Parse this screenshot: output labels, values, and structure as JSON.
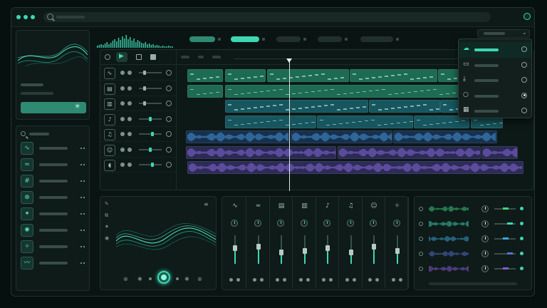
{
  "theme": {
    "accent": "#3fd6b3",
    "bg": "#0a1513",
    "green_clip": "#1d6b52",
    "teal_clip": "#17565e",
    "blue_clip": "#17304e",
    "purple_clip": "#2a2a54"
  },
  "window": {
    "controls": [
      "close-dot",
      "minimize-dot",
      "maximize-dot"
    ]
  },
  "search": {
    "placeholder": ""
  },
  "transport": {
    "buttons": [
      "record",
      "play",
      "loop",
      "stop"
    ]
  },
  "tracks": [
    {
      "icon": "waveform-icon",
      "glyph": "∿"
    },
    {
      "icon": "synth-icon",
      "glyph": "▤"
    },
    {
      "icon": "keyboard-icon",
      "glyph": "▥"
    },
    {
      "icon": "guitar-icon",
      "glyph": "♪"
    },
    {
      "icon": "microphone-icon",
      "glyph": "♫"
    },
    {
      "icon": "group-icon",
      "glyph": "☺"
    },
    {
      "icon": "voice-icon",
      "glyph": "◖"
    }
  ],
  "library": {
    "items": [
      {
        "icon": "wave-icon",
        "glyph": "∿"
      },
      {
        "icon": "wave-icon",
        "glyph": "≈"
      },
      {
        "icon": "grid-icon",
        "glyph": "#"
      },
      {
        "icon": "target-icon",
        "glyph": "⊕"
      },
      {
        "icon": "star-icon",
        "glyph": "✦"
      },
      {
        "icon": "burst-icon",
        "glyph": "✺"
      },
      {
        "icon": "spark-icon",
        "glyph": "✧"
      },
      {
        "icon": "wave-icon",
        "glyph": "〰"
      }
    ]
  },
  "mixer": {
    "channels": [
      {
        "icon": "waveform-icon",
        "glyph": "∿",
        "level": 0.55
      },
      {
        "icon": "wave-icon",
        "glyph": "≈",
        "level": 0.6
      },
      {
        "icon": "synth-icon",
        "glyph": "▤",
        "level": 0.4
      },
      {
        "icon": "keyboard-icon",
        "glyph": "▥",
        "level": 0.45
      },
      {
        "icon": "guitar-icon",
        "glyph": "♪",
        "level": 0.55
      },
      {
        "icon": "microphone-icon",
        "glyph": "♫",
        "level": 0.4
      },
      {
        "icon": "group-icon",
        "glyph": "☺",
        "level": 0.6
      },
      {
        "icon": "spark-icon",
        "glyph": "✧",
        "level": 0.45
      }
    ]
  },
  "dropdown": {
    "items": [
      {
        "icon": "cloud-icon",
        "glyph": "☁",
        "selected": false,
        "highlight": true
      },
      {
        "icon": "comment-icon",
        "glyph": "▭",
        "selected": false,
        "highlight": false
      },
      {
        "icon": "download-icon",
        "glyph": "⤓",
        "selected": false,
        "highlight": false
      },
      {
        "icon": "circle-icon",
        "glyph": "○",
        "selected": true,
        "highlight": false
      },
      {
        "icon": "calendar-icon",
        "glyph": "▦",
        "selected": false,
        "highlight": false
      }
    ]
  },
  "fx_rows": [
    {
      "color": "#3fd67d"
    },
    {
      "color": "#3fd6b3"
    },
    {
      "color": "#3fa6d6"
    },
    {
      "color": "#5a6fd6"
    },
    {
      "color": "#8a5ad6"
    }
  ]
}
